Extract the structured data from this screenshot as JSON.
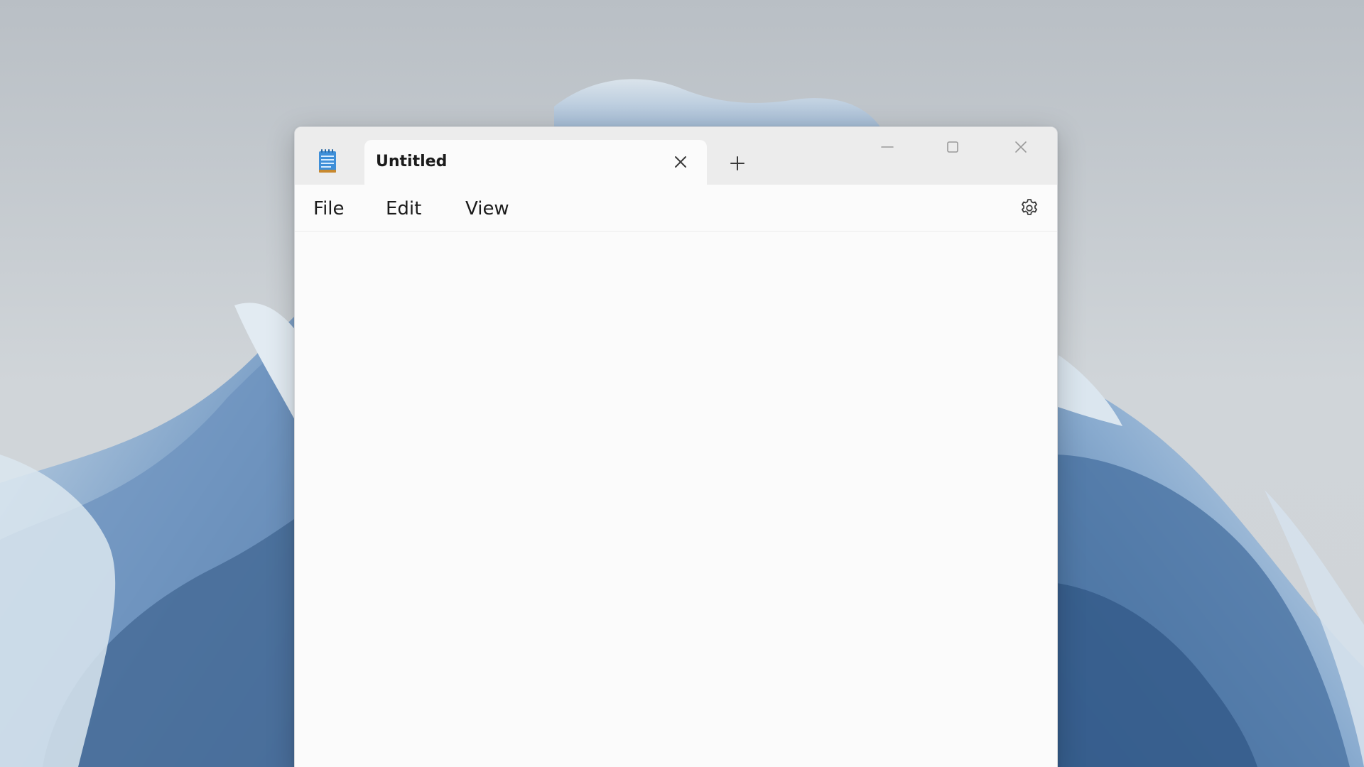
{
  "window": {
    "tab_title": "Untitled",
    "tab_close_icon": "close-icon",
    "new_tab_icon": "plus-icon"
  },
  "caption_buttons": {
    "minimize_icon": "minimize-icon",
    "maximize_icon": "maximize-icon",
    "close_icon": "close-icon"
  },
  "menu": {
    "file": "File",
    "edit": "Edit",
    "view": "View",
    "settings_icon": "gear-icon"
  },
  "editor": {
    "content": ""
  },
  "colors": {
    "titlebar": "#ececec",
    "surface": "#fbfbfb",
    "text": "#1b1b1b",
    "wallpaper_blue": "#5f87b3"
  }
}
